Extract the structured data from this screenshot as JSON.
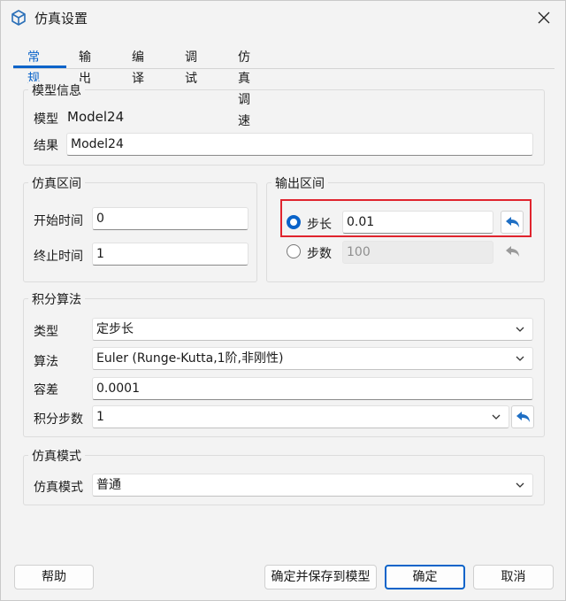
{
  "window": {
    "title": "仿真设置"
  },
  "tabs": [
    {
      "label": "常规"
    },
    {
      "label": "输出"
    },
    {
      "label": "编译"
    },
    {
      "label": "调试"
    },
    {
      "label": "仿真调速"
    }
  ],
  "model_info": {
    "title": "模型信息",
    "model_label": "模型",
    "model_value": "Model24",
    "result_label": "结果",
    "result_value": "Model24"
  },
  "sim_interval": {
    "title": "仿真区间",
    "start_label": "开始时间",
    "start_value": "0",
    "stop_label": "终止时间",
    "stop_value": "1"
  },
  "output_interval": {
    "title": "输出区间",
    "step_label": "步长",
    "step_value": "0.01",
    "count_label": "步数",
    "count_value": "100",
    "selected": "步长"
  },
  "integration": {
    "title": "积分算法",
    "type_label": "类型",
    "type_value": "定步长",
    "algo_label": "算法",
    "algo_value": "Euler (Runge-Kutta,1阶,非刚性)",
    "tolerance_label": "容差",
    "tolerance_value": "0.0001",
    "steps_label": "积分步数",
    "steps_value": "1"
  },
  "sim_mode": {
    "title": "仿真模式",
    "mode_label": "仿真模式",
    "mode_value": "普通"
  },
  "buttons": {
    "help": "帮助",
    "save_to_model": "确定并保存到模型",
    "ok": "确定",
    "cancel": "取消"
  },
  "colors": {
    "accent": "#0a63c9",
    "highlight": "#e0242e"
  }
}
